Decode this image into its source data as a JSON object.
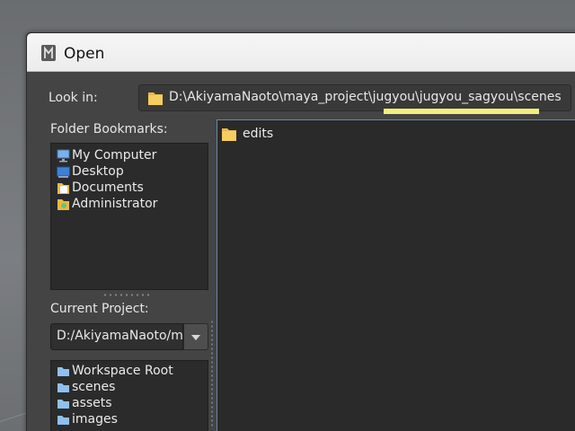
{
  "dialog": {
    "title": "Open",
    "look_in_label": "Look in:",
    "path": "D:\\AkiyamaNaoto\\maya_project\\jugyou\\jugyou_sagyou\\scenes"
  },
  "bookmarks": {
    "label": "Folder Bookmarks:",
    "items": [
      {
        "label": "My Computer",
        "icon": "computer-icon"
      },
      {
        "label": "Desktop",
        "icon": "desktop-icon"
      },
      {
        "label": "Documents",
        "icon": "documents-icon"
      },
      {
        "label": "Administrator",
        "icon": "user-folder-icon"
      }
    ]
  },
  "current_project": {
    "label": "Current Project:",
    "value": "D:/AkiyamaNaoto/maya_project/jugyou/jugyou_sagyou",
    "items": [
      {
        "label": "Workspace Root",
        "icon": "folder-icon"
      },
      {
        "label": "scenes",
        "icon": "folder-icon"
      },
      {
        "label": "assets",
        "icon": "folder-icon"
      },
      {
        "label": "images",
        "icon": "folder-icon"
      }
    ]
  },
  "files": {
    "items": [
      {
        "label": "edits",
        "icon": "folder-icon"
      }
    ]
  },
  "colors": {
    "highlight": "#f3ef7c",
    "panel_bg": "#2b2b2b",
    "dialog_bg": "#444444"
  }
}
